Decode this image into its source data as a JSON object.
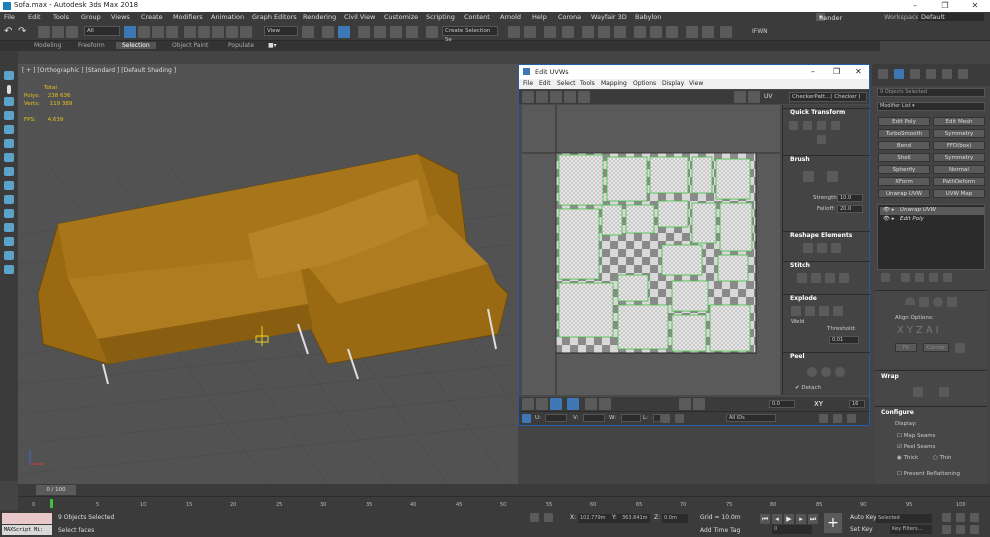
{
  "window": {
    "title": "Sofa.max - Autodesk 3ds Max 2018",
    "minimize": "–",
    "maximize": "❐",
    "close": "✕"
  },
  "menubar": [
    "File",
    "Edit",
    "Tools",
    "Group",
    "Views",
    "Create",
    "Modifiers",
    "Animation",
    "Graph Editors",
    "Rendering",
    "Civil View",
    "Customize",
    "Scripting",
    "Content",
    "Arnold",
    "Help",
    "Corona",
    "Wayfair 3D",
    "Babylon"
  ],
  "user": {
    "name": "Render Slav...",
    "workspaces_label": "Workspaces:",
    "workspace": "Default"
  },
  "toolbar": {
    "filter_all": "All",
    "view_dropdown": "View",
    "selection_set": "Create Selection Se",
    "ifwn": "IFWN"
  },
  "ribbon": {
    "tabs": [
      "Modeling",
      "Freeform",
      "Selection",
      "Object Paint",
      "Populate"
    ],
    "active": "Selection"
  },
  "viewport": {
    "label": "[ + ] [Orthographic ] [Standard ] [Default Shading ]",
    "stats": {
      "total_label": "Total",
      "polys_label": "Polys:",
      "polys": "238 636",
      "verts_label": "Verts:",
      "verts": "119 389",
      "fps_label": "FPS:",
      "fps": "4.639"
    }
  },
  "uvw": {
    "title": "Edit UVWs",
    "menu": [
      "File",
      "Edit",
      "Select",
      "Tools",
      "Mapping",
      "Options",
      "Display",
      "View"
    ],
    "uv_label": "UV",
    "checker_dropdown": "CheckerPatt...( Checker )",
    "sections": {
      "quick_transform": "Quick Transform",
      "brush": "Brush",
      "strength_label": "Strength:",
      "strength": "10.0",
      "falloff_label": "Falloff:",
      "falloff": "20.0",
      "reshape": "Reshape Elements",
      "stitch": "Stitch",
      "explode": "Explode",
      "weld": "Weld",
      "threshold_label": "Threshold:",
      "threshold": "0.01",
      "peel": "Peel",
      "detach": "Detach"
    },
    "bottom": {
      "value": "0.0",
      "xy": "XY",
      "spinner": "16"
    },
    "status": {
      "u_label": "U:",
      "v_label": "V:",
      "w_label": "W:",
      "l_label": "L:",
      "ids": "All IDs"
    }
  },
  "cmdpanel": {
    "selection_info": "9 Objects Selected",
    "modifier_list": "Modifier List",
    "modifier_buttons": [
      "Edit Poly",
      "Edit Mesh",
      "TurboSmooth",
      "Symmetry",
      "Bend",
      "FFD(box)",
      "Shell",
      "Symmetry",
      "Spherify",
      "Normal",
      "XForm",
      "PathDeform",
      "Unwrap UVW",
      "UVW Map"
    ],
    "stack": [
      "Unwrap UVW",
      "Edit Poly"
    ],
    "align_options": "Align Options:",
    "align_letters": [
      "X",
      "Y",
      "Z",
      "A",
      "I"
    ],
    "fit": "Fit",
    "center": "Center",
    "wrap": "Wrap",
    "configure": "Configure",
    "display": "Display:",
    "map_seams": "Map Seams",
    "peel_seams": "Peel Seams",
    "thick": "Thick",
    "thin": "Thin",
    "prevent": "Prevent Reflattening"
  },
  "timeline": {
    "frame": "0 / 100"
  },
  "ruler": [
    "0",
    "5",
    "10",
    "15",
    "20",
    "25",
    "30",
    "35",
    "40",
    "45",
    "50",
    "55",
    "60",
    "65",
    "70",
    "75",
    "80",
    "85",
    "90",
    "95",
    "100"
  ],
  "status": {
    "maxscript": "MAXScript Mi:",
    "objects_selected": "9 Objects Selected",
    "prompt": "Select faces",
    "x_label": "X:",
    "x": "102.779m",
    "y_label": "Y:",
    "y": "363.841m",
    "z_label": "Z:",
    "z": "0.0m",
    "grid": "Grid = 10.0m",
    "add_time_tag": "Add Time Tag",
    "frame": "0",
    "auto_key": "Auto Key",
    "selected": "Selected",
    "set_key": "Set Key",
    "key_filters": "Key Filters..."
  },
  "colors": {
    "sofa": "#9a6a12",
    "accent_blue": "#3d78b5",
    "uv_green": "#3fc13f",
    "stats_yellow": "#e8c020"
  }
}
